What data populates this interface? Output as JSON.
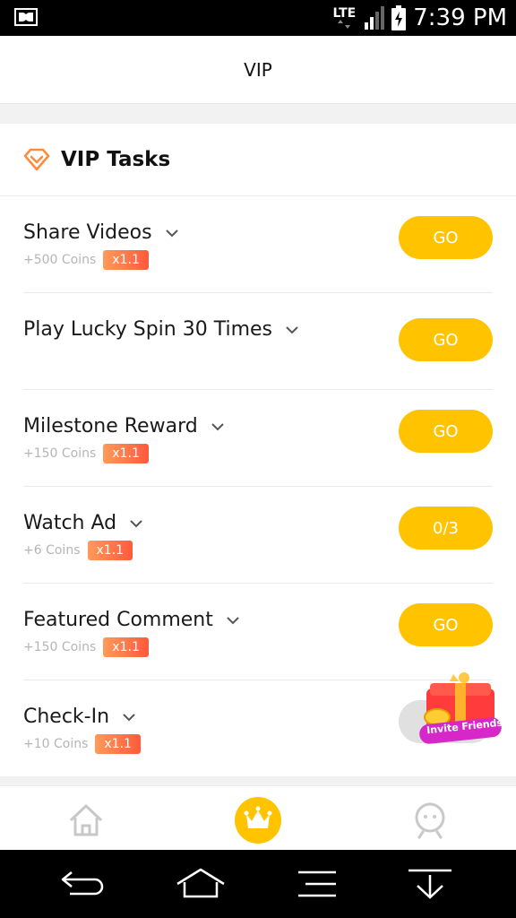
{
  "status_bar": {
    "network": "LTE",
    "time": "7:39 PM"
  },
  "header": {
    "title": "VIP"
  },
  "section": {
    "title": "VIP Tasks"
  },
  "tasks": [
    {
      "name": "Share Videos",
      "coins": "+500 Coins",
      "multiplier": "x1.1",
      "action": "GO"
    },
    {
      "name": "Play Lucky Spin 30 Times",
      "coins": "",
      "multiplier": "",
      "action": "GO"
    },
    {
      "name": "Milestone Reward",
      "coins": "+150 Coins",
      "multiplier": "x1.1",
      "action": "GO"
    },
    {
      "name": "Watch Ad",
      "coins": "+6 Coins",
      "multiplier": "x1.1",
      "action": "0/3"
    },
    {
      "name": "Featured Comment",
      "coins": "+150 Coins",
      "multiplier": "x1.1",
      "action": "GO"
    },
    {
      "name": "Check-In",
      "coins": "+10 Coins",
      "multiplier": "x1.1",
      "action": ""
    }
  ],
  "invite": {
    "label": "Invite Friends"
  },
  "tabbar": {
    "items": [
      "home-icon",
      "crown-icon",
      "profile-icon"
    ]
  },
  "colors": {
    "accent": "#ffc300",
    "badge_start": "#ff9a5a",
    "badge_end": "#ff5a3c"
  }
}
